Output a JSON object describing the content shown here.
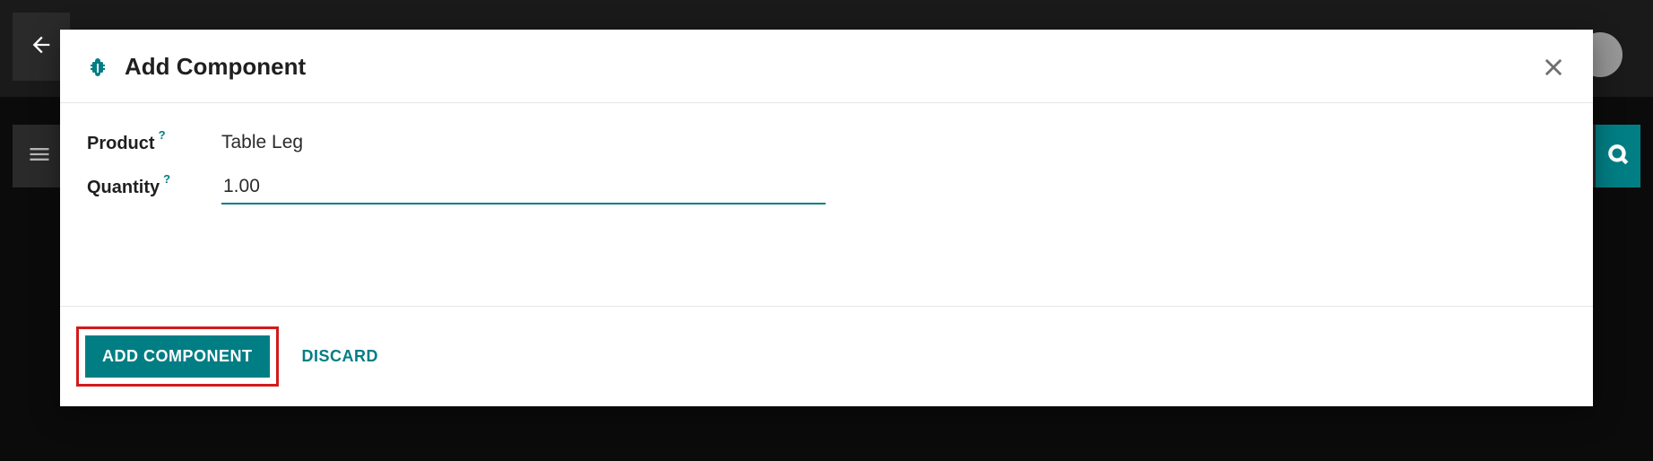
{
  "modal": {
    "title": "Add Component",
    "fields": {
      "product": {
        "label": "Product",
        "value": "Table Leg"
      },
      "quantity": {
        "label": "Quantity",
        "value": "1.00"
      }
    },
    "help_glyph": "?",
    "footer": {
      "primary_label": "Add Component",
      "discard_label": "Discard"
    }
  }
}
